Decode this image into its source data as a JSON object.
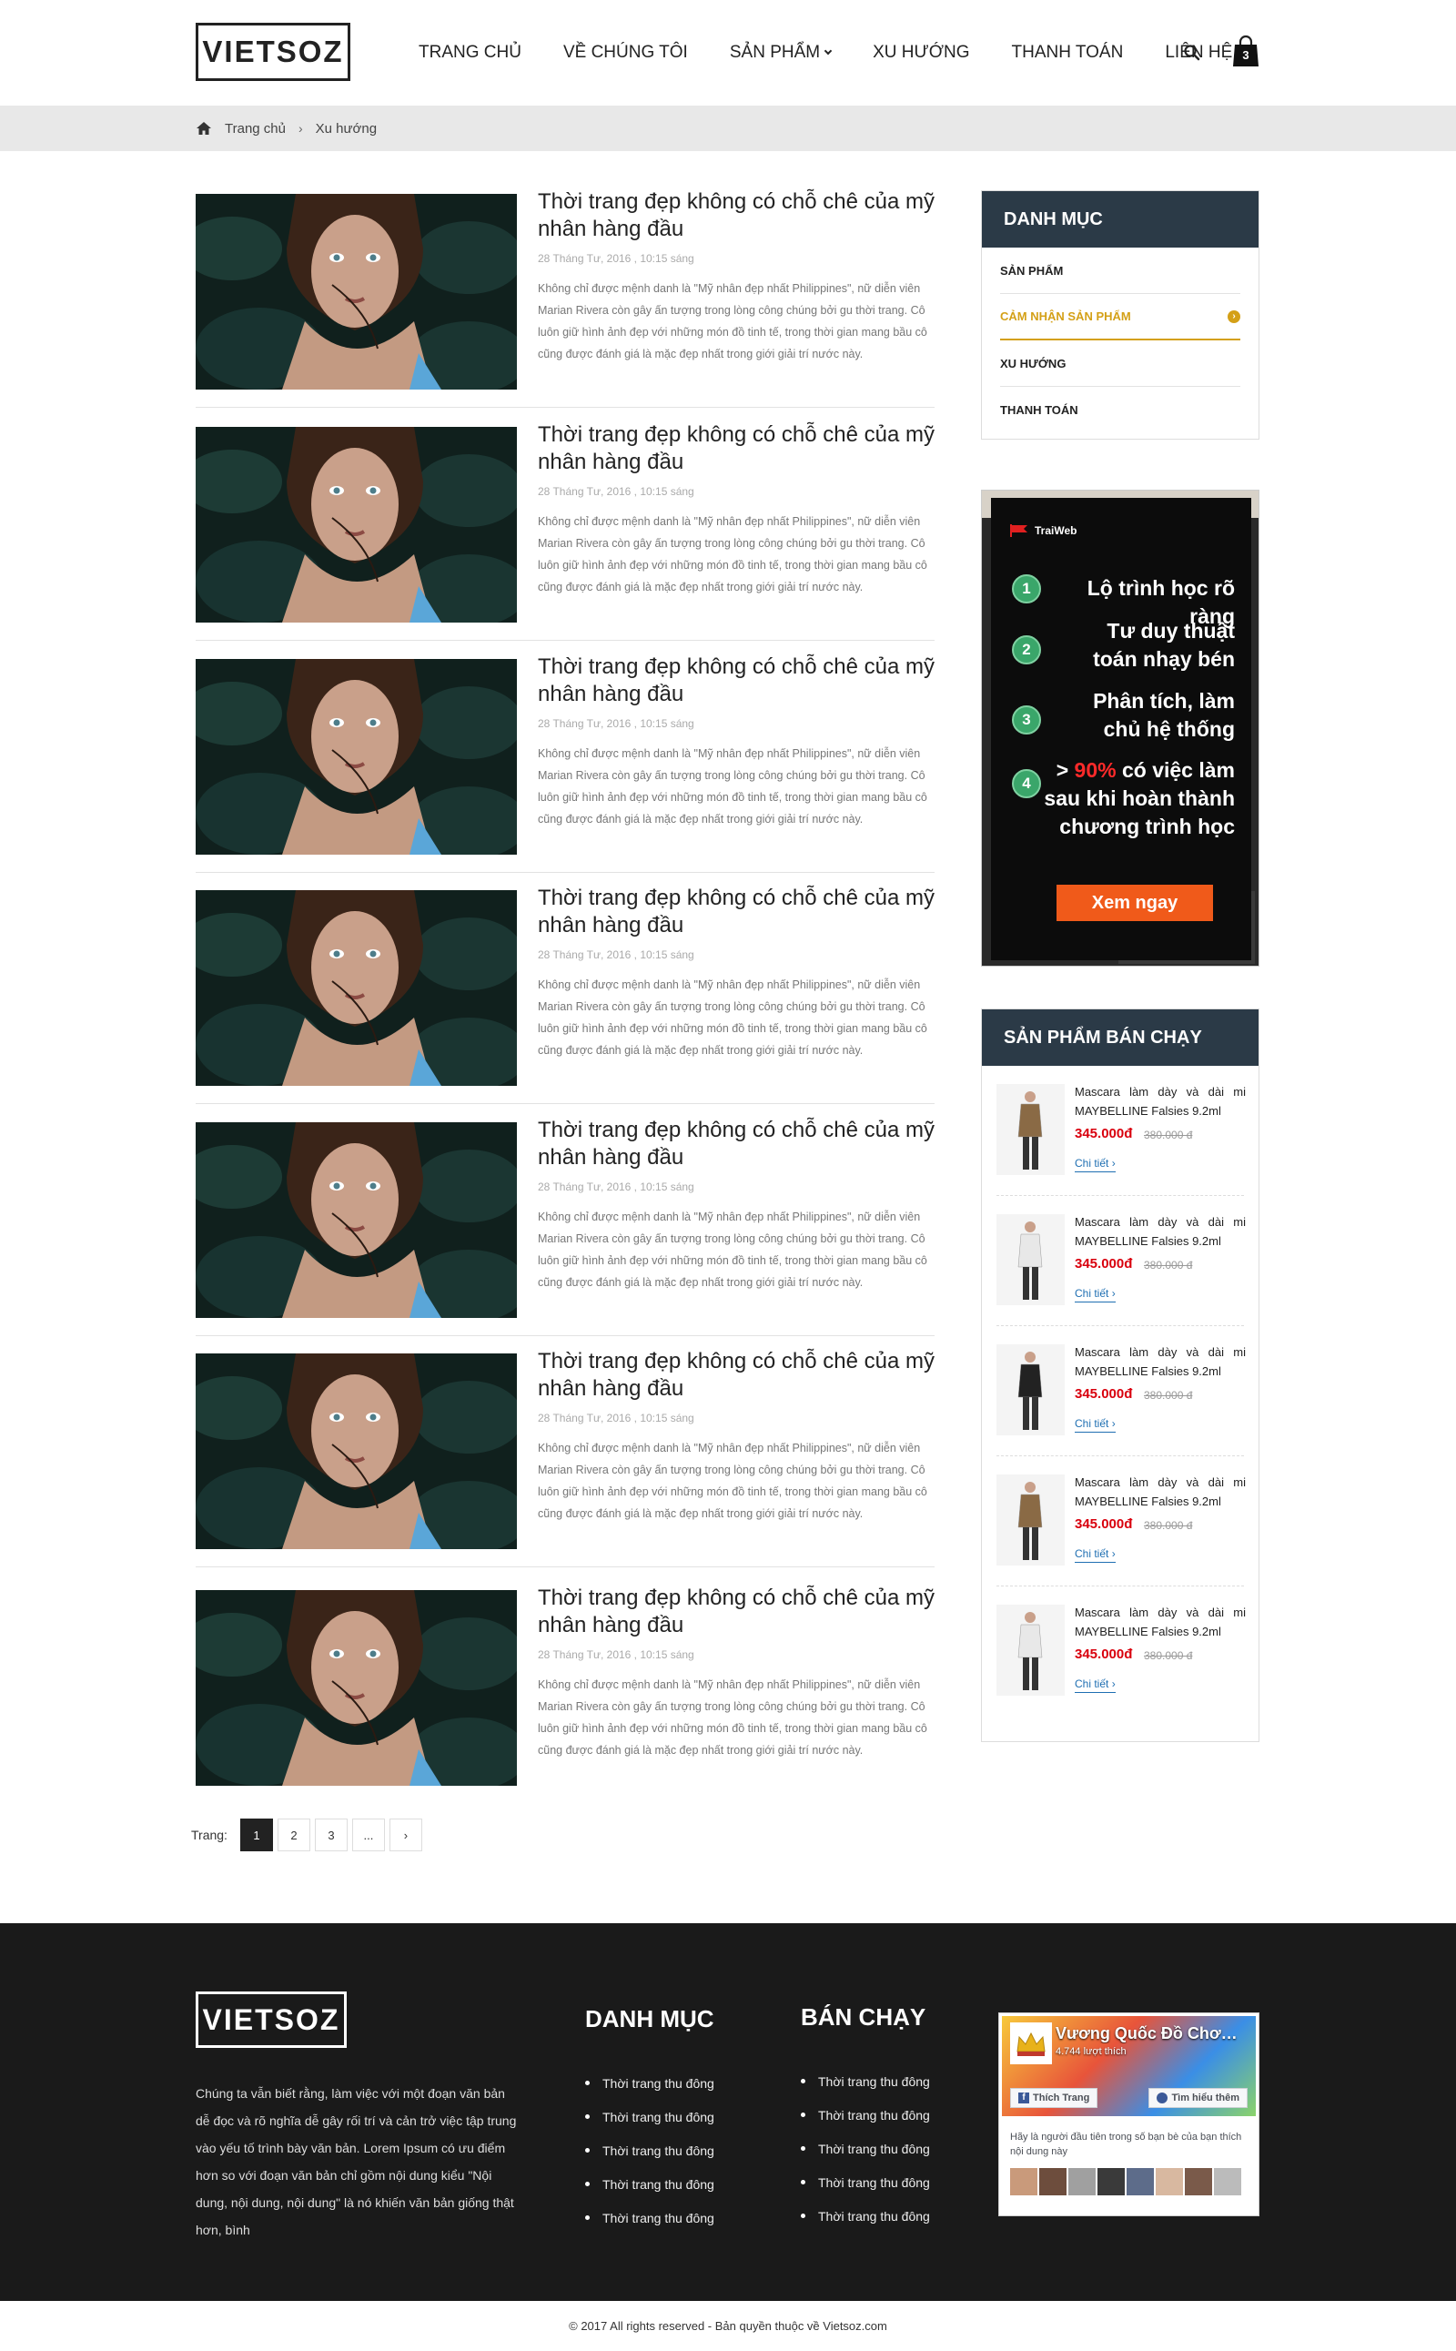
{
  "header": {
    "logo": "VIETSOZ",
    "nav": [
      {
        "label": "TRANG CHỦ"
      },
      {
        "label": "VỀ CHÚNG TÔI"
      },
      {
        "label": "SẢN PHẨM"
      },
      {
        "label": "XU HƯỚNG"
      },
      {
        "label": "THANH TOÁN"
      },
      {
        "label": "LIÊN HỆ"
      }
    ],
    "cart_count": "3",
    "icons": {
      "search": "search-icon",
      "cart": "shopping-bag-icon"
    }
  },
  "breadcrumb": {
    "home": "Trang chủ",
    "current": "Xu hướng"
  },
  "articles": [
    {
      "title": "Thời trang đẹp không có chỗ chê của mỹ nhân hàng đầu",
      "date": "28 Tháng Tư, 2016 , 10:15 sáng",
      "excerpt": "Không chỉ được mệnh danh là \"Mỹ nhân đẹp nhất Philippines\", nữ diễn viên Marian Rivera còn gây ấn tượng trong lòng công chúng bởi gu thời trang. Cô luôn giữ hình ảnh đẹp với những món đồ tinh tế, trong thời gian mang  bầu cô cũng được đánh giá là mặc đẹp nhất trong giới giải trí nước này."
    },
    {
      "title": "Thời trang đẹp không có chỗ chê của mỹ nhân hàng đầu",
      "date": "28 Tháng Tư, 2016 , 10:15 sáng",
      "excerpt": "Không chỉ được mệnh danh là \"Mỹ nhân đẹp nhất Philippines\", nữ diễn viên Marian Rivera còn gây ấn tượng trong lòng công chúng bởi gu thời trang. Cô luôn giữ hình ảnh đẹp với những món đồ tinh tế, trong thời gian mang  bầu cô cũng được đánh giá là mặc đẹp nhất trong giới giải trí nước này."
    },
    {
      "title": "Thời trang đẹp không có chỗ chê của mỹ nhân hàng đầu",
      "date": "28 Tháng Tư, 2016 , 10:15 sáng",
      "excerpt": "Không chỉ được mệnh danh là \"Mỹ nhân đẹp nhất Philippines\", nữ diễn viên Marian Rivera còn gây ấn tượng trong lòng công chúng bởi gu thời trang. Cô luôn giữ hình ảnh đẹp với những món đồ tinh tế, trong thời gian mang  bầu cô cũng được đánh giá là mặc đẹp nhất trong giới giải trí nước này."
    },
    {
      "title": "Thời trang đẹp không có chỗ chê của mỹ nhân hàng đầu",
      "date": "28 Tháng Tư, 2016 , 10:15 sáng",
      "excerpt": "Không chỉ được mệnh danh là \"Mỹ nhân đẹp nhất Philippines\", nữ diễn viên Marian Rivera còn gây ấn tượng trong lòng công chúng bởi gu thời trang. Cô luôn giữ hình ảnh đẹp với những món đồ tinh tế, trong thời gian mang  bầu cô cũng được đánh giá là mặc đẹp nhất trong giới giải trí nước này."
    },
    {
      "title": "Thời trang đẹp không có chỗ chê của mỹ nhân hàng đầu",
      "date": "28 Tháng Tư, 2016 , 10:15 sáng",
      "excerpt": "Không chỉ được mệnh danh là \"Mỹ nhân đẹp nhất Philippines\", nữ diễn viên Marian Rivera còn gây ấn tượng trong lòng công chúng bởi gu thời trang. Cô luôn giữ hình ảnh đẹp với những món đồ tinh tế, trong thời gian mang  bầu cô cũng được đánh giá là mặc đẹp nhất trong giới giải trí nước này."
    },
    {
      "title": "Thời trang đẹp không có chỗ chê của mỹ nhân hàng đầu",
      "date": "28 Tháng Tư, 2016 , 10:15 sáng",
      "excerpt": "Không chỉ được mệnh danh là \"Mỹ nhân đẹp nhất Philippines\", nữ diễn viên Marian Rivera còn gây ấn tượng trong lòng công chúng bởi gu thời trang. Cô luôn giữ hình ảnh đẹp với những món đồ tinh tế, trong thời gian mang  bầu cô cũng được đánh giá là mặc đẹp nhất trong giới giải trí nước này."
    },
    {
      "title": "Thời trang đẹp không có chỗ chê của mỹ nhân hàng đầu",
      "date": "28 Tháng Tư, 2016 , 10:15 sáng",
      "excerpt": "Không chỉ được mệnh danh là \"Mỹ nhân đẹp nhất Philippines\", nữ diễn viên Marian Rivera còn gây ấn tượng trong lòng công chúng bởi gu thời trang. Cô luôn giữ hình ảnh đẹp với những món đồ tinh tế, trong thời gian mang  bầu cô cũng được đánh giá là mặc đẹp nhất trong giới giải trí nước này."
    }
  ],
  "pagination": {
    "label": "Trang:",
    "pages": [
      "1",
      "2",
      "3",
      "..."
    ],
    "active": "1",
    "next_icon": "chevron-right-icon"
  },
  "sidebar": {
    "categories": {
      "title": "DANH MỤC",
      "items": [
        {
          "label": "SẢN PHẨM"
        },
        {
          "label": "CẢM NHẬN SẢN PHẨM"
        },
        {
          "label": "XU HƯỚNG"
        },
        {
          "label": "THANH TOÁN"
        }
      ]
    },
    "ad": {
      "brand": "TraiWeb",
      "steps": [
        {
          "num": "1",
          "text": "Lộ trình học rõ ràng"
        },
        {
          "num": "2",
          "text": "Tư duy thuật toán nhạy bén"
        },
        {
          "num": "3",
          "text": "Phân tích, làm chủ hệ thống"
        },
        {
          "num": "4",
          "prefix": "> ",
          "highlight": "90%",
          "text": " có việc làm sau khi hoàn thành chương trình học"
        }
      ],
      "button": "Xem ngay"
    },
    "bestsellers": {
      "title": "SẢN PHẨM BÁN CHẠY",
      "items": [
        {
          "name": "Mascara làm dày và dài mi MAYBELLINE Falsies 9.2ml",
          "price": "345.000đ",
          "old_price": "380.000 đ",
          "more": "Chi tiết"
        },
        {
          "name": "Mascara làm dày và dài mi MAYBELLINE Falsies 9.2ml",
          "price": "345.000đ",
          "old_price": "380.000 đ",
          "more": "Chi tiết"
        },
        {
          "name": "Mascara làm dày và dài mi MAYBELLINE Falsies 9.2ml",
          "price": "345.000đ",
          "old_price": "380.000 đ",
          "more": "Chi tiết"
        },
        {
          "name": "Mascara làm dày và dài mi MAYBELLINE Falsies 9.2ml",
          "price": "345.000đ",
          "old_price": "380.000 đ",
          "more": "Chi tiết"
        },
        {
          "name": "Mascara làm dày và dài mi MAYBELLINE Falsies 9.2ml",
          "price": "345.000đ",
          "old_price": "380.000 đ",
          "more": "Chi tiết"
        }
      ]
    }
  },
  "footer": {
    "logo": "VIETSOZ",
    "description": "Chúng ta vẫn biết rằng, làm việc với một đoạn văn bản dễ đọc và rõ nghĩa dễ gây rối trí và cản trở việc tập trung vào yếu tố trình bày văn bản. Lorem Ipsum có ưu điểm hơn so với đoạn văn bản chỉ gồm nội dung kiểu \"Nội dung, nội dung, nội dung\" là nó khiến văn bản giống thật hơn, bình",
    "col1": {
      "title": "DANH MỤC",
      "items": [
        "Thời trang thu đông",
        "Thời trang thu đông",
        "Thời trang thu đông",
        "Thời trang thu đông",
        "Thời trang thu đông"
      ]
    },
    "col2": {
      "title": "BÁN CHẠY",
      "items": [
        "Thời trang thu đông",
        "Thời trang thu đông",
        "Thời trang thu đông",
        "Thời trang thu đông",
        "Thời trang thu đông"
      ]
    },
    "facebook": {
      "page_name": "Vương Quốc Đồ Chơi...",
      "likes": "4.744 lượt thích",
      "like_btn": "Thích Trang",
      "learn_btn": "Tìm hiểu thêm",
      "friends_text": "Hãy là người đầu tiên trong số bạn bè của bạn thích nội dung này"
    },
    "copyright": "© 2017  All rights reserved -  Bản quyền thuộc về Vietsoz.com"
  }
}
